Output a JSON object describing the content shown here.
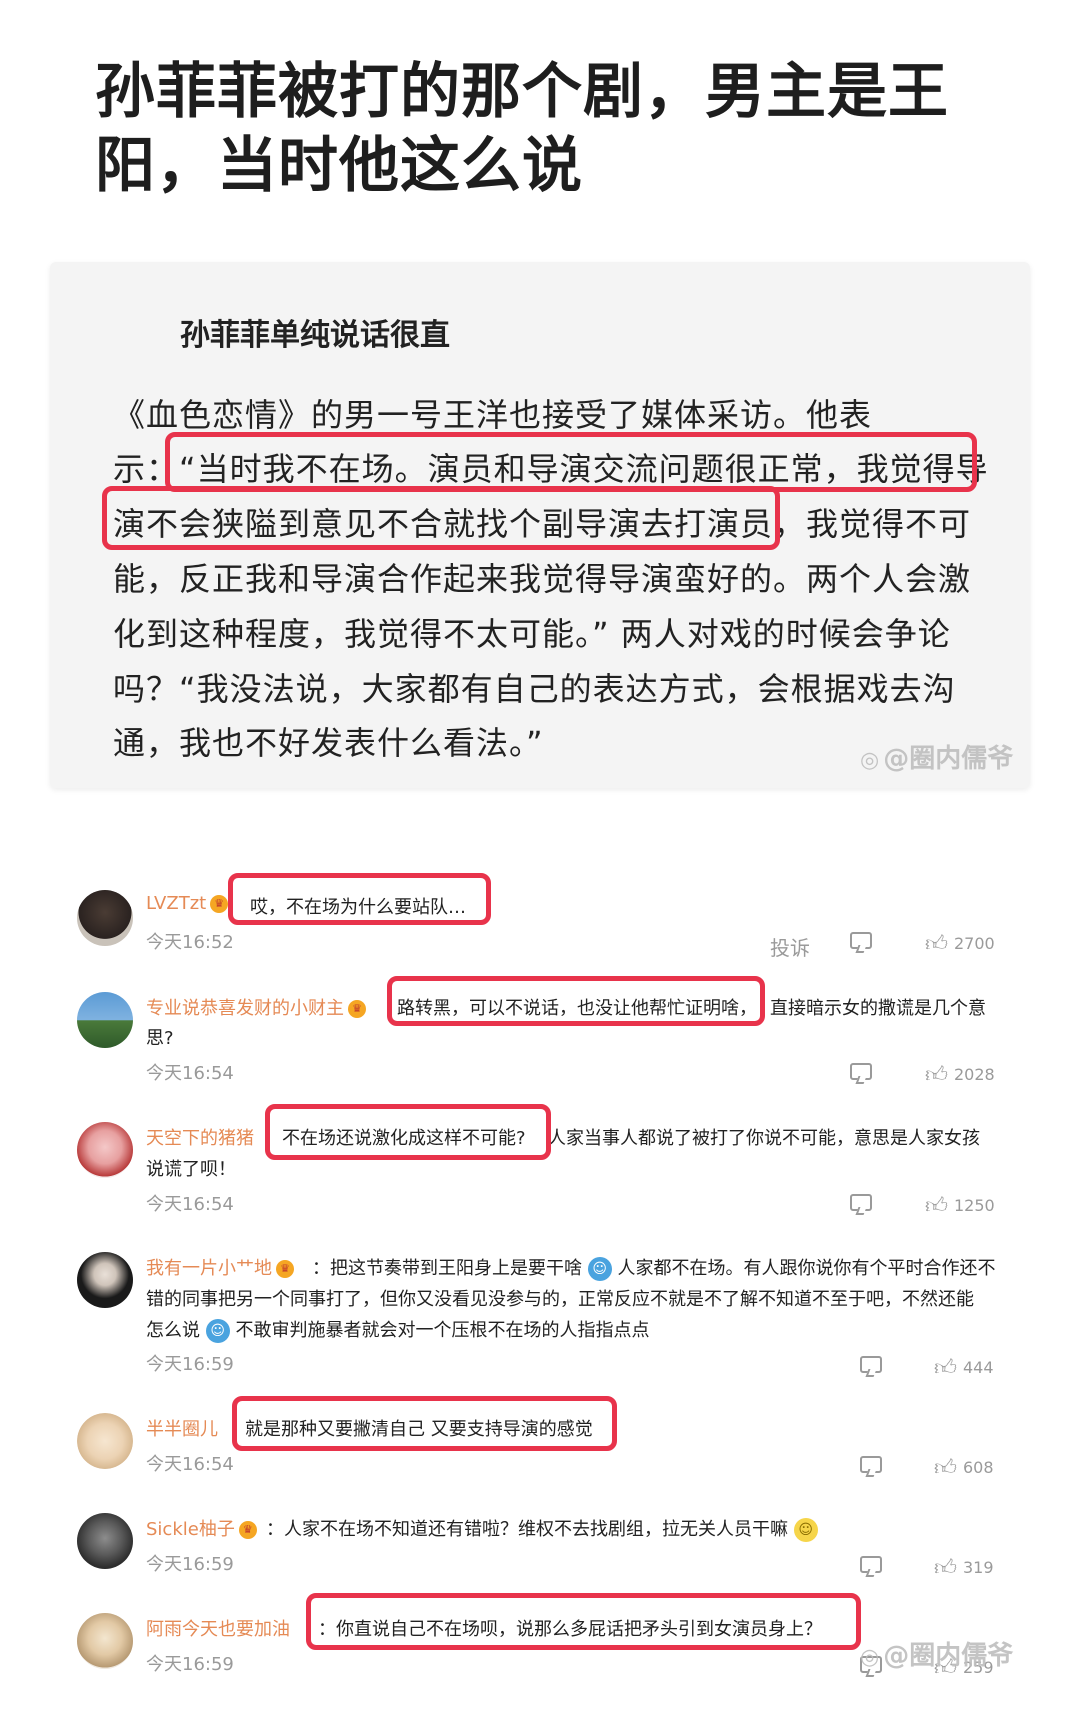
{
  "headline": {
    "line1": "孙菲菲被打的那个剧，男主是王",
    "line2": "阳，当时他这么说"
  },
  "article": {
    "heading": "孙菲菲单纯说话很直",
    "lines": [
      "《血色恋情》的男一号王洋也接受了媒体采访。他表",
      "示：“当时我不在场。演员和导演交流问题很正常，我觉得导",
      "演不会狭隘到意见不合就找个副导演去打演员，我觉得不可",
      "能，反正我和导演合作起来我觉得导演蛮好的。两个人会激",
      "化到这种程度，我觉得不太可能。” 两人对戏的时候会争论",
      "吗？“我没法说，大家都有自己的表达方式，会根据戏去沟",
      "通，我也不好发表什么看法。”"
    ]
  },
  "watermark": "@圈内儒爷",
  "comments": [
    {
      "name": "LVZTzt",
      "text": "哎，不在场为什么要站队…",
      "time": "今天16:52",
      "report": "投诉",
      "likes": "2700"
    },
    {
      "name": "专业说恭喜发财的小财主",
      "text": "路转黑，可以不说话，也没让他帮忙证明啥，",
      "text_rest": "直接暗示女的撒谎是几个意",
      "text_line2": "思?",
      "time": "今天16:54",
      "likes": "2028"
    },
    {
      "name": "天空下的猪猪",
      "text": "不在场还说激化成这样不可能?",
      "text_rest": "人家当事人都说了被打了你说不可能，意思是人家女孩",
      "text_line2": "说谎了呗！",
      "time": "今天16:54",
      "likes": "1250"
    },
    {
      "name": "我有一片小艹地",
      "line1a": "：把这节奏带到王阳身上是要干啥",
      "line1b": "人家都不在场。有人跟你说你有个平时合作还不",
      "line2": "错的同事把另一个同事打了，但你又没看见没参与的，正常反应不就是不了解不知道不至于吧，不然还能",
      "line3a": "怎么说",
      "line3b": "不敢审判施暴者就会对一个压根不在场的人指指点点",
      "time": "今天16:59",
      "likes": "444"
    },
    {
      "name": "半半圈儿",
      "text": "就是那种又要撇清自己 又要支持导演的感觉",
      "time": "今天16:54",
      "likes": "608"
    },
    {
      "name": "Sickle柚子",
      "text": "：人家不在场不知道还有错啦？维权不去找剧组，拉无关人员干嘛",
      "time": "今天16:59",
      "likes": "319"
    },
    {
      "name": "阿雨今天也要加油",
      "text": "：你直说自己不在场呗，说那么多屁话把矛头引到女演员身上？",
      "time": "今天16:59",
      "likes": "259"
    }
  ],
  "colors": {
    "highlight": "#e8334b",
    "username": "#e58a55",
    "meta": "#9a9a9a"
  },
  "icons": [
    "reply-icon",
    "like-icon",
    "vip-badge-icon",
    "emoji-icon",
    "watermark-logo-icon"
  ]
}
